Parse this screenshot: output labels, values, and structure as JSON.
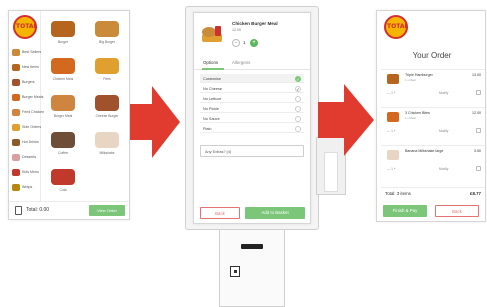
{
  "brand": {
    "logo_text": "TOTAL",
    "accent_red": "#d32f2f",
    "accent_green": "#7cc67a",
    "arrow_red": "#e03b2e"
  },
  "menu_screen": {
    "categories": [
      {
        "label": "Best Sellers",
        "color": "#c98a3a"
      },
      {
        "label": "New Items",
        "color": "#b5651d"
      },
      {
        "label": "Burgers",
        "color": "#a0522d"
      },
      {
        "label": "Burger Meals",
        "color": "#d2691e"
      },
      {
        "label": "Fried Chicken",
        "color": "#cd853f"
      },
      {
        "label": "Side Orders",
        "color": "#e0a030"
      },
      {
        "label": "Hot Drinks",
        "color": "#8b5a2b"
      },
      {
        "label": "Desserts",
        "color": "#d9a0a0"
      },
      {
        "label": "Kids Menu",
        "color": "#c0392b"
      },
      {
        "label": "Wraps",
        "color": "#b8860b"
      }
    ],
    "items": [
      {
        "name": "Burger",
        "color": "#b5651d"
      },
      {
        "name": "Big Burger",
        "color": "#c98a3a"
      },
      {
        "name": "Chicken Meal",
        "color": "#d2691e"
      },
      {
        "name": "Fries",
        "color": "#e0a030"
      },
      {
        "name": "Burger Meal",
        "color": "#cd853f"
      },
      {
        "name": "Cheese Burger",
        "color": "#a0522d"
      },
      {
        "name": "Coffee",
        "color": "#6f4e37"
      },
      {
        "name": "Milkshake",
        "color": "#e8d5c4"
      },
      {
        "name": "Cola",
        "color": "#c0392b"
      }
    ],
    "footer": {
      "total": "Total: 0.00",
      "view_order": "View Order"
    }
  },
  "product_screen": {
    "name": "Chicken Burger Meal",
    "price": "12.00",
    "qty": "1",
    "tabs": [
      "Options",
      "Allergens"
    ],
    "options_header": "Customise",
    "options": [
      {
        "label": "No Cheese",
        "checked": "✓"
      },
      {
        "label": "No Lettuce",
        "checked": ""
      },
      {
        "label": "No Pickle",
        "checked": ""
      },
      {
        "label": "No Sauce",
        "checked": ""
      },
      {
        "label": "Plain",
        "checked": ""
      }
    ],
    "extra_note": "Any Extras? (4)",
    "back": "Back",
    "add": "Add to Basket"
  },
  "order_screen": {
    "title": "Your Order",
    "lines": [
      {
        "name": "Triple Hamburger",
        "sub": "1 x Meal",
        "price": "13.00",
        "qty": "— 1 +",
        "modify": "Modify",
        "color": "#b5651d"
      },
      {
        "name": "3 Chicken Bites",
        "sub": "1 x Meal",
        "price": "12.00",
        "qty": "— 1 +",
        "modify": "Modify",
        "color": "#d2691e"
      },
      {
        "name": "Banana Milkshake large",
        "sub": "",
        "price": "3.50",
        "qty": "— 1 +",
        "modify": "Modify",
        "color": "#e8d5c4"
      }
    ],
    "total_label": "Total: 3 items",
    "total_value": "£8.77",
    "finish": "Finish & Pay",
    "back": "Back"
  }
}
